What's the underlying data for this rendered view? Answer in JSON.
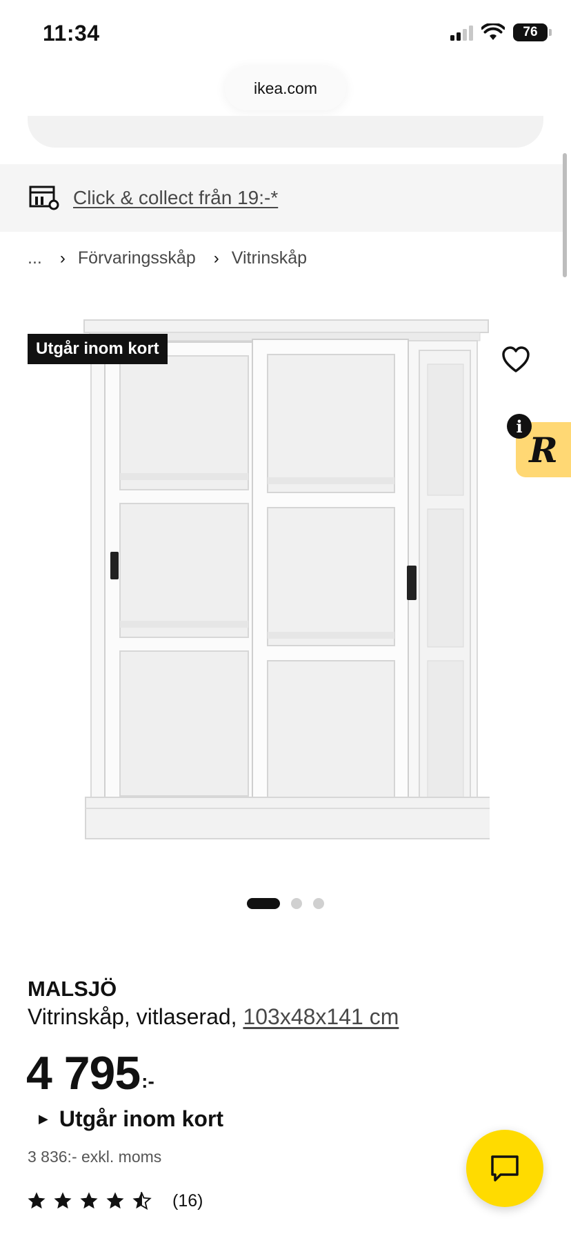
{
  "status_bar": {
    "time": "11:34",
    "battery": "76"
  },
  "browser": {
    "url": "ikea.com"
  },
  "collect_banner": {
    "text": "Click & collect från 19:-*",
    "icon": "store-pickup-icon"
  },
  "breadcrumb": [
    {
      "label": "..."
    },
    {
      "label": "Förvaringsskåp"
    },
    {
      "label": "Vitrinskåp"
    }
  ],
  "product": {
    "badge": "Utgår inom kort",
    "name": "MALSJÖ",
    "description": "Vitrinskåp, vitlaserad, ",
    "dimensions": "103x48x141 cm",
    "price": "4 795",
    "price_suffix": ":-",
    "stock_status": "Utgår inom kort",
    "price_excl_vat": "3 836:- exkl. moms",
    "rating": 4.5,
    "rating_max": 5,
    "review_count": "(16)",
    "image_count": 3,
    "active_image": 1
  },
  "widgets": {
    "r_label": "R",
    "info_label": "i"
  },
  "colors": {
    "accent_yellow": "#ffdb00",
    "widget_yellow": "#ffd874",
    "banner_bg": "#f5f5f5",
    "text": "#111111"
  }
}
